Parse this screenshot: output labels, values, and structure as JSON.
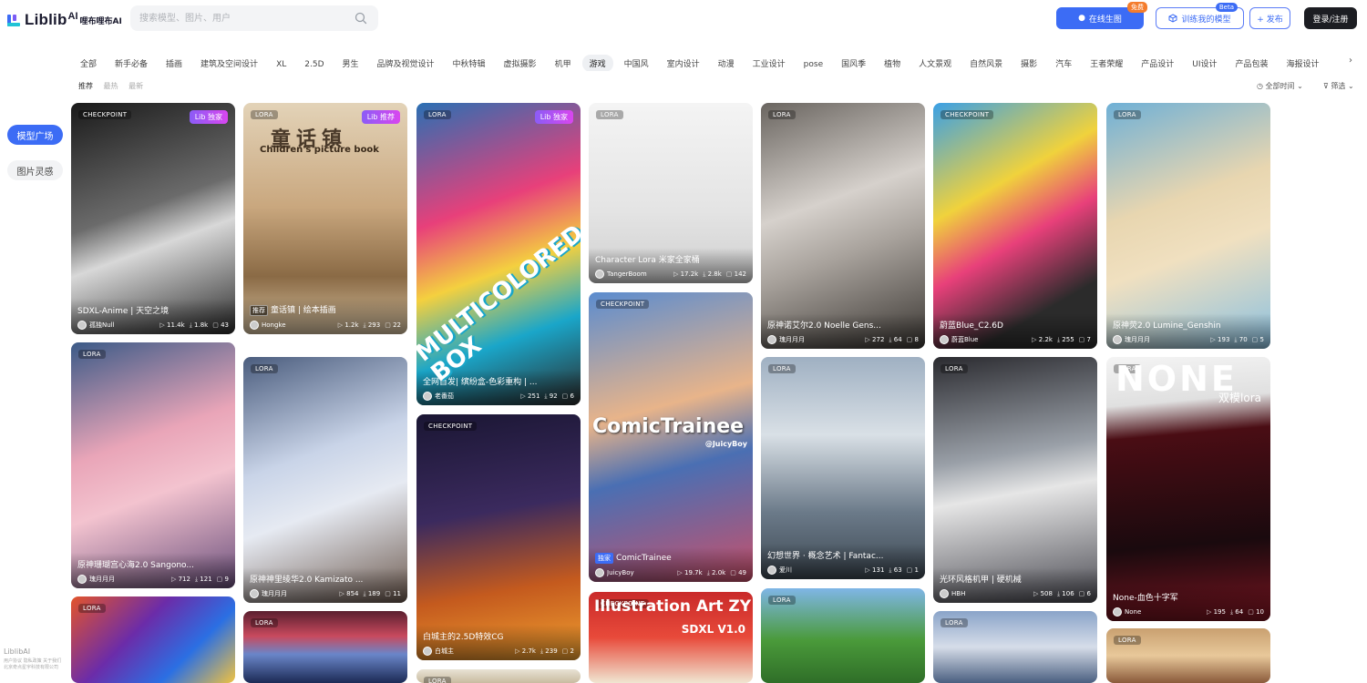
{
  "brand": {
    "name": "Liblib",
    "ai": "AI",
    "cn": "哩布哩布AI"
  },
  "search": {
    "placeholder": "搜索模型、图片、用户"
  },
  "header": {
    "draw_label": "在线生图",
    "draw_badge": "免费",
    "train_label": "训练我的模型",
    "train_badge": "Beta",
    "publish_label": "+ 发布",
    "login_label": "登录/注册"
  },
  "categories": [
    "全部",
    "新手必备",
    "插画",
    "建筑及空间设计",
    "XL",
    "2.5D",
    "男生",
    "品牌及视觉设计",
    "中秋特辑",
    "虚拟摄影",
    "机甲",
    "游戏",
    "中国风",
    "室内设计",
    "动漫",
    "工业设计",
    "pose",
    "国风季",
    "植物",
    "人文景观",
    "自然风景",
    "摄影",
    "汽车",
    "王者荣耀",
    "产品设计",
    "UI设计",
    "产品包装",
    "海报设计"
  ],
  "active_category": "游戏",
  "sorts": [
    "推荐",
    "最热",
    "最新"
  ],
  "filters": {
    "time": "全部时间",
    "filter": "筛选"
  },
  "sidebar": {
    "items": [
      {
        "label": "模型广场"
      },
      {
        "label": "图片灵感"
      }
    ]
  },
  "footer": {
    "brand": "LiblibAI",
    "lines": [
      "用户协议  隐私政策  关于我们",
      "北京奇点星宇科技有限公司"
    ]
  },
  "cards": [
    {
      "tag": "CHECKPOINT",
      "exclusive": "Lib 独家",
      "title": "SDXL-Anime | 天空之境",
      "author": "孤独Null",
      "downloads": "11.4k",
      "likes": "1.8k",
      "comments": "43",
      "bg": "linear-gradient(160deg,#1a1a1a,#6b6b6b 45%,#d8d8d8 60%,#2b2b2b)"
    },
    {
      "tag": "LORA",
      "exclusive": "",
      "title": "原神珊瑚宫心海2.0 Sangono...",
      "author": "瑰月月月",
      "downloads": "712",
      "likes": "121",
      "comments": "9",
      "bg": "linear-gradient(160deg,#3b5a87,#e9a5b8 40%,#f3c3cf 60%,#6a4f7c)"
    },
    {
      "tag": "LORA",
      "exclusive": "",
      "title": "",
      "author": "",
      "downloads": "",
      "likes": "",
      "comments": "",
      "bg": "linear-gradient(135deg,#e3542b,#6b2ca9 40%,#2b6fe3 70%,#f0c241)"
    },
    {
      "tag": "LORA",
      "exclusive": "Lib 推荐",
      "title": "童话镇 | 绘本插画",
      "ptag": "推荐",
      "author": "Hongke",
      "downloads": "1.2k",
      "likes": "293",
      "comments": "22",
      "bg": "linear-gradient(180deg,#e3d3b8,#c9a77e 45%,#8a6a45 75%,#d6c1a0)"
    },
    {
      "tag": "LORA",
      "exclusive": "",
      "title": "原神神里绫华2.0 Kamizato ...",
      "author": "瑰月月月",
      "downloads": "854",
      "likes": "189",
      "comments": "11",
      "bg": "linear-gradient(160deg,#4b5d7e,#c9d4e8 40%,#e6eaf2 60%,#6d5a4f)"
    },
    {
      "tag": "LORA",
      "exclusive": "",
      "title": "",
      "author": "",
      "downloads": "",
      "likes": "",
      "comments": "",
      "bg": "linear-gradient(180deg,#5b1f2f,#c84a5e 35%,#6a86c9 60%,#1c2a55)"
    },
    {
      "tag": "LORA",
      "exclusive": "Lib 独家",
      "title": "全网首发| 缤纷盒-色彩重构 | ...",
      "author": "老番茄",
      "downloads": "251",
      "likes": "92",
      "comments": "6",
      "bg": "linear-gradient(160deg,#2a6fb3,#e8407a 35%,#f4d03f 55%,#1aa6c9 75%,#2b2b2b)"
    },
    {
      "tag": "CHECKPOINT",
      "exclusive": "",
      "title": "白城主的2.5D特效CG",
      "author": "白城主",
      "downloads": "2.7k",
      "likes": "239",
      "comments": "2",
      "bg": "linear-gradient(170deg,#1a1633,#3b2a5e 40%,#c45a1e 70%,#f0a030)"
    },
    {
      "tag": "LORA",
      "exclusive": "",
      "title": "",
      "author": "",
      "downloads": "",
      "likes": "",
      "comments": "",
      "bg": "linear-gradient(180deg,#e8e2d4,#c9bba0)"
    },
    {
      "tag": "LORA",
      "exclusive": "",
      "title": "Character Lora 米家全家桶",
      "author": "TangerBoom",
      "downloads": "17.2k",
      "likes": "2.8k",
      "comments": "142",
      "bg": "linear-gradient(180deg,#f4f4f4,#e4e4e4 60%,#cfcfcf)"
    },
    {
      "tag": "CHECKPOINT",
      "exclusive": "",
      "title": "ComicTrainee",
      "ptag": "独家",
      "author": "JuicyBoy",
      "downloads": "19.7k",
      "likes": "2.0k",
      "comments": "49",
      "bg": "linear-gradient(165deg,#5b8ccf,#e8b48a 40%,#4a6fb3 60%,#c9506a)"
    },
    {
      "tag": "CHECKPOINT",
      "exclusive": "",
      "title": "",
      "author": "",
      "downloads": "",
      "likes": "",
      "comments": "",
      "bg": "linear-gradient(180deg,#c92a2a,#e84a3a 50%,#f0e6d2)"
    },
    {
      "tag": "LORA",
      "exclusive": "",
      "title": "原神诺艾尔2.0 Noelle Gens...",
      "author": "瑰月月月",
      "downloads": "272",
      "likes": "64",
      "comments": "8",
      "bg": "linear-gradient(160deg,#6a6560,#d6d1cc 40%,#a8a29c 60%,#3a3632)"
    },
    {
      "tag": "LORA",
      "exclusive": "",
      "title": "幻想世界 · 概念艺术 | Fantac...",
      "author": "爱川",
      "downloads": "131",
      "likes": "63",
      "comments": "1",
      "bg": "linear-gradient(180deg,#9fb0c2,#d9e0e6 35%,#6b7a89 70%,#3d4852)"
    },
    {
      "tag": "LORA",
      "exclusive": "",
      "title": "",
      "author": "",
      "downloads": "",
      "likes": "",
      "comments": "",
      "bg": "linear-gradient(180deg,#7fb6e6,#4a9a3a 55%,#2f6e28)"
    },
    {
      "tag": "CHECKPOINT",
      "exclusive": "",
      "title": "蔚蓝Blue_C2.6D",
      "author": "蔚蓝Blue",
      "downloads": "2.2k",
      "likes": "255",
      "comments": "7",
      "bg": "linear-gradient(150deg,#3aa0e6,#f0d23c 35%,#e8407a 55%,#2b2b2b 80%)"
    },
    {
      "tag": "LORA",
      "exclusive": "",
      "title": "光环风格机甲 | 硬机械",
      "author": "HBH",
      "downloads": "508",
      "likes": "106",
      "comments": "6",
      "bg": "linear-gradient(170deg,#2b2b30,#9aa0a8 40%,#e6e6e6 55%,#4a4a52)"
    },
    {
      "tag": "LORA",
      "exclusive": "",
      "title": "",
      "author": "",
      "downloads": "",
      "likes": "",
      "comments": "",
      "bg": "linear-gradient(180deg,#8aa4c9,#d6dde9 50%,#4a5f80)"
    },
    {
      "tag": "LORA",
      "exclusive": "",
      "title": "原神荧2.0 Lumine_Genshin",
      "author": "瑰月月月",
      "downloads": "193",
      "likes": "70",
      "comments": "5",
      "bg": "linear-gradient(160deg,#6fb0d6,#e8d6b0 40%,#f0e0c0 60%,#8ac0e0)"
    },
    {
      "tag": "LORA",
      "exclusive": "",
      "title": "None-血色十字军",
      "author": "None",
      "downloads": "195",
      "likes": "64",
      "comments": "10",
      "bg": "linear-gradient(175deg,#f4f4f4,#e0e0e0 18%,#4a0d14 30%,#1a0a0e 70%,#7a1420)"
    },
    {
      "tag": "LORA",
      "exclusive": "",
      "title": "",
      "author": "",
      "downloads": "",
      "likes": "",
      "comments": "",
      "bg": "linear-gradient(180deg,#c9a070,#e8c89a 50%,#8a5a3a)"
    }
  ],
  "overlays": {
    "comic": "ComicTrainee",
    "comic_author": "@JuicyBoy",
    "illus": "Illustration Art ZY",
    "illus_sub": "SDXL V1.0",
    "none_big": "NONE",
    "none_sub": "双模lora",
    "fairy": "童话镇",
    "fairy_en": "Children's picture book",
    "multi": "MULTICOLORED BOX"
  }
}
